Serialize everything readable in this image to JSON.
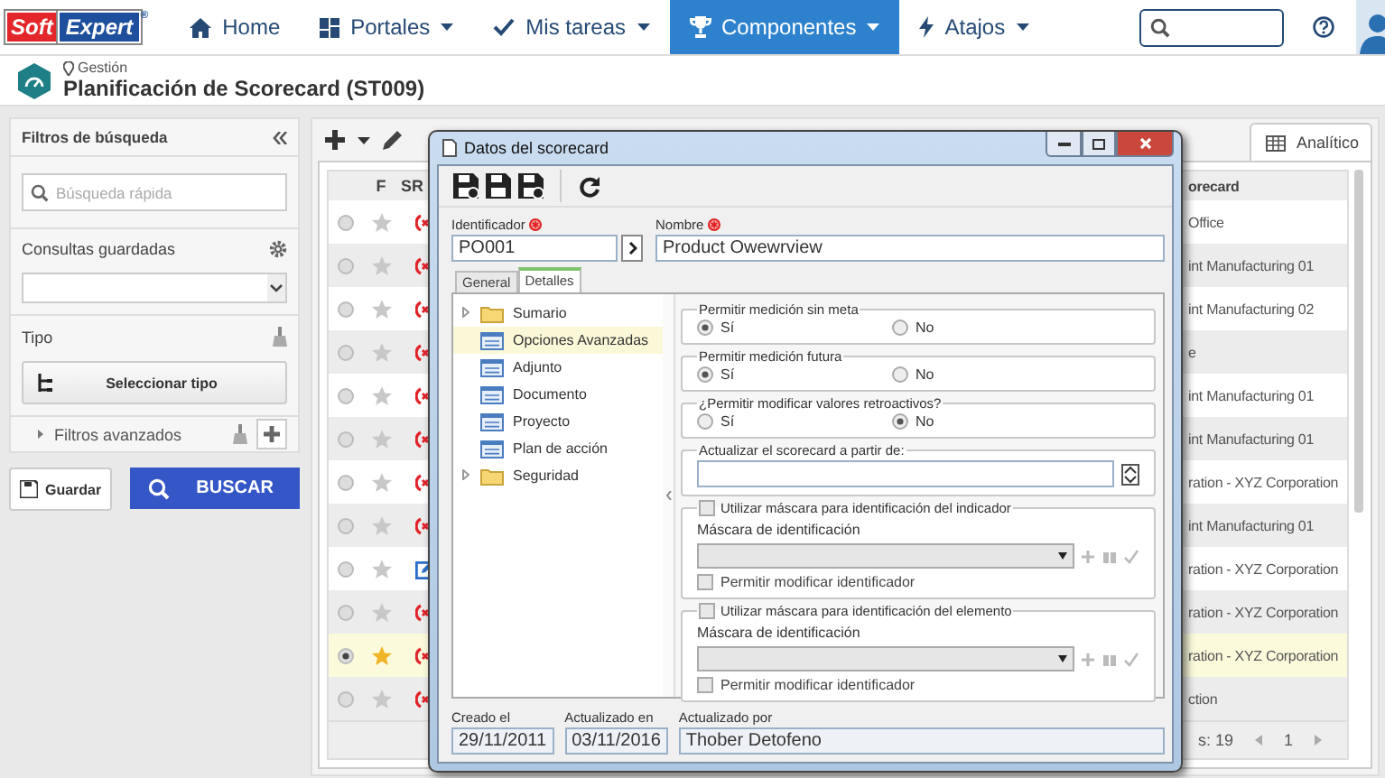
{
  "nav": {
    "logo": {
      "part_1": "Soft",
      "part_2": "Expert",
      "mark": "®"
    },
    "menu": [
      {
        "label": "Home",
        "selected": false,
        "dropdown": false
      },
      {
        "label": "Portales",
        "selected": false,
        "dropdown": true
      },
      {
        "label": "Mis tareas",
        "selected": false,
        "dropdown": true
      },
      {
        "label": "Componentes",
        "selected": true,
        "dropdown": true
      },
      {
        "label": "Atajos",
        "selected": false,
        "dropdown": true
      }
    ]
  },
  "header": {
    "breadcrumb": "Gestión",
    "title": "Planificación de Scorecard (ST009)"
  },
  "filters": {
    "title": "Filtros de búsqueda",
    "search": {
      "placeholder": "Búsqueda rápida"
    },
    "saved_queries": {
      "label": "Consultas guardadas"
    },
    "type": {
      "label": "Tipo",
      "button": "Seleccionar tipo"
    },
    "advanced": {
      "label": "Filtros avanzados",
      "expanded": false
    },
    "save_button": "Guardar",
    "search_button": "BUSCAR"
  },
  "grid": {
    "view_tab": "Analítico",
    "columns": [
      "F",
      "SR",
      "orecard"
    ],
    "rows": [
      {
        "selected": false,
        "favorite": false,
        "kind": "alert",
        "column_4": "Office"
      },
      {
        "selected": false,
        "favorite": false,
        "kind": "alert",
        "column_4": "int Manufacturing 01"
      },
      {
        "selected": false,
        "favorite": false,
        "kind": "alert",
        "column_4": "int Manufacturing 02"
      },
      {
        "selected": false,
        "favorite": false,
        "kind": "alert",
        "column_4": "e"
      },
      {
        "selected": false,
        "favorite": false,
        "kind": "alert",
        "column_4": "int Manufacturing 01"
      },
      {
        "selected": false,
        "favorite": false,
        "kind": "alert",
        "column_4": "int Manufacturing 01"
      },
      {
        "selected": false,
        "favorite": false,
        "kind": "alert",
        "column_4": "ration - XYZ Corporation"
      },
      {
        "selected": false,
        "favorite": false,
        "kind": "alert",
        "column_4": "int Manufacturing 01"
      },
      {
        "selected": false,
        "favorite": false,
        "kind": "edit",
        "column_4": "ration - XYZ Corporation"
      },
      {
        "selected": false,
        "favorite": false,
        "kind": "alert",
        "column_4": "ration - XYZ Corporation"
      },
      {
        "selected": true,
        "favorite": true,
        "kind": "alert",
        "column_4": "ration - XYZ Corporation"
      },
      {
        "selected": false,
        "favorite": false,
        "kind": "alert",
        "column_4": "ction"
      }
    ],
    "footer": {
      "count": "s: 19",
      "page": "1"
    }
  },
  "dialog": {
    "title": "Datos del scorecard",
    "identifier": {
      "label": "Identificador",
      "value": "PO001",
      "required": true
    },
    "name": {
      "label": "Nombre",
      "value": "Product Owewrview",
      "required": true
    },
    "tabs": [
      {
        "label": "General",
        "selected": false
      },
      {
        "label": "Detalles",
        "selected": true
      }
    ],
    "tree": [
      {
        "label": "Sumario",
        "kind": "folder",
        "selected": false
      },
      {
        "label": "Opciones Avanzadas",
        "kind": "page",
        "selected": true
      },
      {
        "label": "Adjunto",
        "kind": "page",
        "selected": false
      },
      {
        "label": "Documento",
        "kind": "page",
        "selected": false
      },
      {
        "label": "Proyecto",
        "kind": "page",
        "selected": false
      },
      {
        "label": "Plan de acción",
        "kind": "page",
        "selected": false
      },
      {
        "label": "Seguridad",
        "kind": "folder",
        "selected": false
      }
    ],
    "groups": [
      {
        "kind": "radio",
        "title": "Permitir medición sin meta",
        "options": [
          {
            "label": "Sí",
            "selected": true
          },
          {
            "label": "No",
            "selected": false
          }
        ]
      },
      {
        "kind": "radio",
        "title": "Permitir medición futura",
        "options": [
          {
            "label": "Sí",
            "selected": true
          },
          {
            "label": "No",
            "selected": false
          }
        ]
      },
      {
        "kind": "radio",
        "title": "¿Permitir modificar valores retroactivos?",
        "options": [
          {
            "label": "Sí",
            "selected": false
          },
          {
            "label": "No",
            "selected": true
          }
        ]
      },
      {
        "kind": "date",
        "title": "Actualizar el scorecard a partir de:"
      },
      {
        "kind": "mask",
        "title": "Utilizar máscara para identificación del indicador",
        "checked": false,
        "field_label": "Máscara de identificación",
        "option": {
          "label": "Permitir modificar identificador",
          "checked": false
        }
      },
      {
        "kind": "mask",
        "title": "Utilizar máscara para identificación del elemento",
        "checked": false,
        "field_label": "Máscara de identificación",
        "option": {
          "label": "Permitir modificar identificador",
          "checked": false
        }
      }
    ],
    "footer": [
      {
        "label": "Creado el",
        "value": "29/11/2011"
      },
      {
        "label": "Actualizado en",
        "value": "03/11/2016"
      },
      {
        "label": "Actualizado por",
        "value": "Thober Detofeno"
      }
    ]
  }
}
